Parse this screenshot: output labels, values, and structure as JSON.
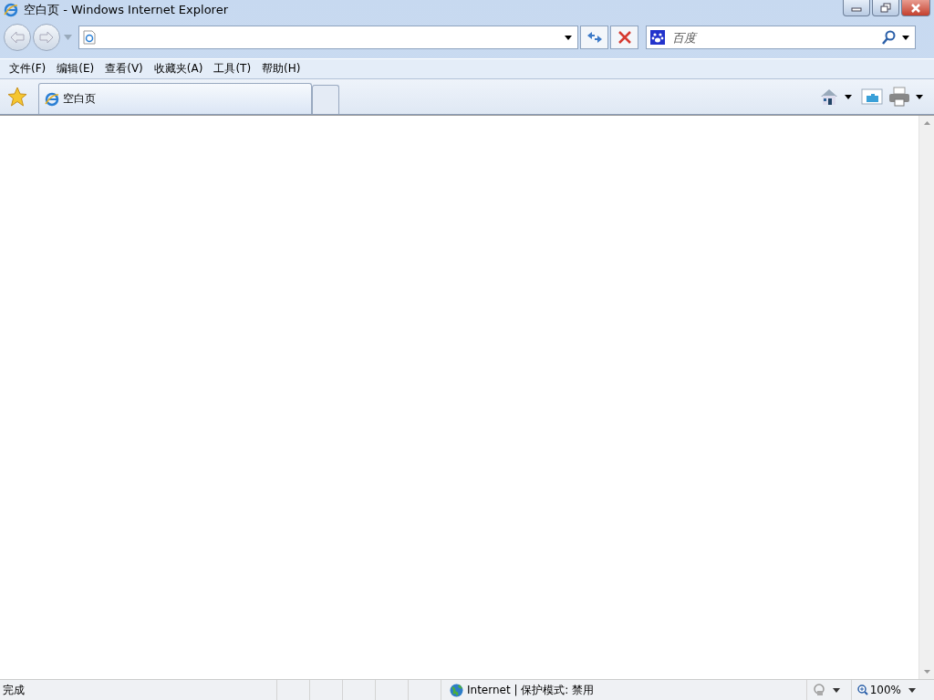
{
  "window": {
    "title": "空白页 - Windows Internet Explorer"
  },
  "search": {
    "placeholder": "百度"
  },
  "menu": [
    {
      "label": "文件(F)"
    },
    {
      "label": "编辑(E)"
    },
    {
      "label": "查看(V)"
    },
    {
      "label": "收藏夹(A)"
    },
    {
      "label": "工具(T)"
    },
    {
      "label": "帮助(H)"
    }
  ],
  "tabs": [
    {
      "label": "空白页",
      "selected": true
    }
  ],
  "status_bar": {
    "status": "完成",
    "zone": "Internet | 保护模式: 禁用",
    "zoom": "100%"
  }
}
